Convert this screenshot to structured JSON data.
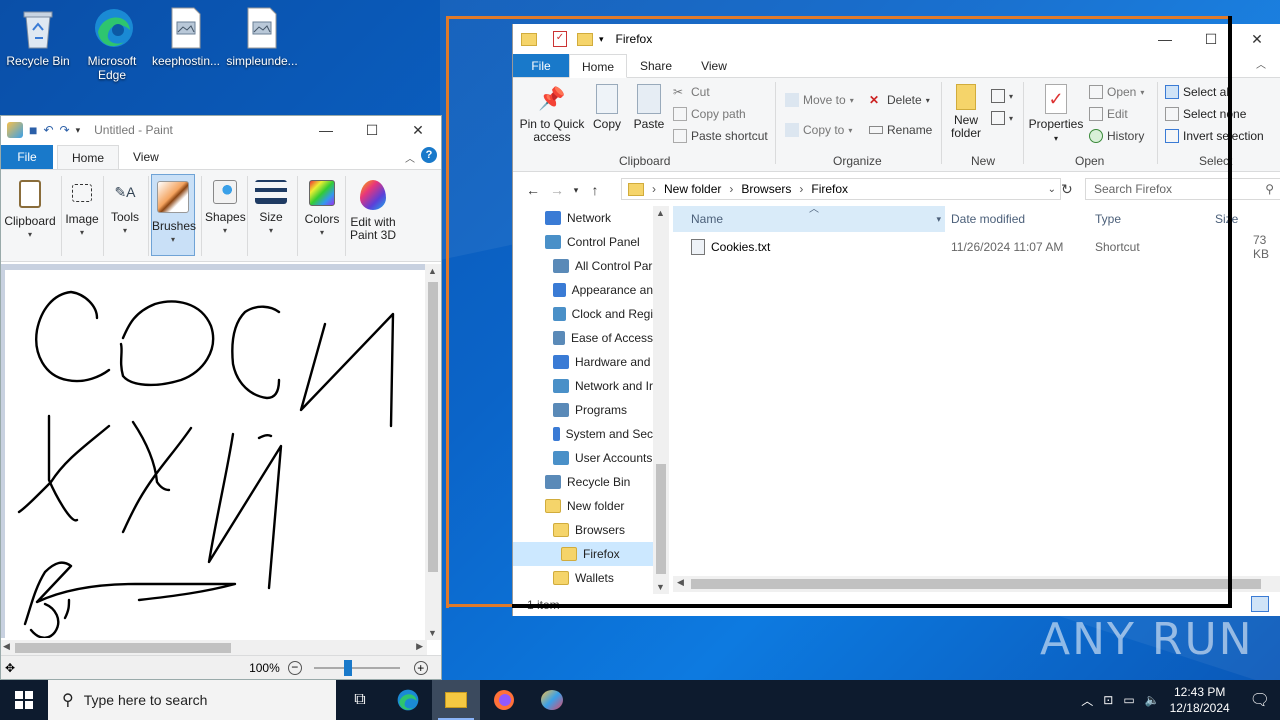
{
  "desktop": {
    "icons": [
      {
        "label": "Recycle Bin",
        "icon": "recycle-bin-icon"
      },
      {
        "label": "Microsoft Edge",
        "icon": "edge-icon"
      },
      {
        "label": "keephostin...",
        "icon": "file-icon"
      },
      {
        "label": "simpleunde...",
        "icon": "file-icon"
      }
    ],
    "watermark": "ANY RUN"
  },
  "paint": {
    "title": "Untitled - Paint",
    "tabs": [
      "File",
      "Home",
      "View"
    ],
    "ribbon": [
      {
        "label": "Clipboard",
        "icon": "clipboard-icon"
      },
      {
        "label": "Image",
        "icon": "image-select-icon"
      },
      {
        "label": "Tools",
        "icon": "tools-icon"
      },
      {
        "label": "Brushes",
        "icon": "brush-icon",
        "selected": true
      },
      {
        "label": "Shapes",
        "icon": "shapes-icon"
      },
      {
        "label": "Size",
        "icon": "size-icon"
      },
      {
        "label": "Colors",
        "icon": "colors-icon"
      },
      {
        "label": "Edit with Paint 3D",
        "icon": "paint3d-icon"
      }
    ],
    "zoom": "100%",
    "zoom_fraction": 0.4
  },
  "explorer": {
    "title": "Firefox",
    "tabs": [
      "File",
      "Home",
      "Share",
      "View"
    ],
    "clipboard": {
      "pin": "Pin to Quick access",
      "copy": "Copy",
      "paste": "Paste",
      "cut": "Cut",
      "copy_path": "Copy path",
      "paste_shortcut": "Paste shortcut",
      "group": "Clipboard"
    },
    "organize": {
      "move_to": "Move to",
      "copy_to": "Copy to",
      "delete": "Delete",
      "rename": "Rename",
      "group": "Organize"
    },
    "new": {
      "new_folder": "New folder",
      "group": "New"
    },
    "open": {
      "properties": "Properties",
      "open": "Open",
      "edit": "Edit",
      "history": "History",
      "group": "Open"
    },
    "select": {
      "select_all": "Select all",
      "select_none": "Select none",
      "invert": "Invert selection",
      "group": "Select"
    },
    "breadcrumb": [
      "New folder",
      "Browsers",
      "Firefox"
    ],
    "search_placeholder": "Search Firefox",
    "nav": [
      {
        "label": "Network",
        "indent": 0
      },
      {
        "label": "Control Panel",
        "indent": 0
      },
      {
        "label": "All Control Par",
        "indent": 1
      },
      {
        "label": "Appearance an",
        "indent": 1
      },
      {
        "label": "Clock and Regi",
        "indent": 1
      },
      {
        "label": "Ease of Access",
        "indent": 1
      },
      {
        "label": "Hardware and",
        "indent": 1
      },
      {
        "label": "Network and Ir",
        "indent": 1
      },
      {
        "label": "Programs",
        "indent": 1
      },
      {
        "label": "System and Sec",
        "indent": 1
      },
      {
        "label": "User Accounts",
        "indent": 1
      },
      {
        "label": "Recycle Bin",
        "indent": 0
      },
      {
        "label": "New folder",
        "indent": 0
      },
      {
        "label": "Browsers",
        "indent": 1
      },
      {
        "label": "Firefox",
        "indent": 2,
        "selected": true
      },
      {
        "label": "Wallets",
        "indent": 1
      }
    ],
    "columns": [
      "Name",
      "Date modified",
      "Type",
      "Size"
    ],
    "files": [
      {
        "name": "Cookies.txt",
        "date": "11/26/2024 11:07 AM",
        "type": "Shortcut",
        "size": "73 KB"
      }
    ],
    "status": "1 item"
  },
  "taskbar": {
    "search_placeholder": "Type here to search",
    "time": "12:43 PM",
    "date": "12/18/2024"
  },
  "colors": {
    "accent": "#1979ca",
    "selection": "#cce8ff",
    "highlight_frame": "#e07a2a"
  }
}
